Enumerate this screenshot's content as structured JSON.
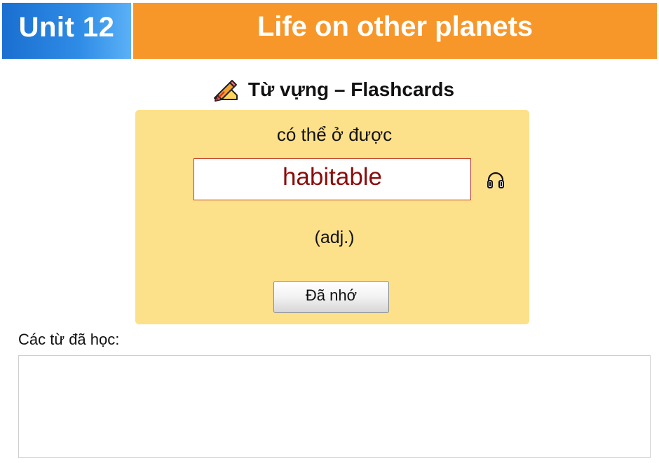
{
  "header": {
    "unit": "Unit 12",
    "title": "Life on other planets"
  },
  "section": {
    "title": "Từ vựng – Flashcards",
    "icon": "pencil-writing-icon"
  },
  "card": {
    "meaning": "có thể ở được",
    "word": "habitable",
    "part_of_speech": "(adj.)",
    "audio_icon": "headphones-icon",
    "remember_button": "Đã nhớ"
  },
  "learned": {
    "label": "Các từ đã học:",
    "items": []
  },
  "colors": {
    "unit_bg": "#1a6fd0",
    "title_bg": "#f7972a",
    "card_bg": "#fde08a",
    "word_color": "#8b0d0d"
  }
}
